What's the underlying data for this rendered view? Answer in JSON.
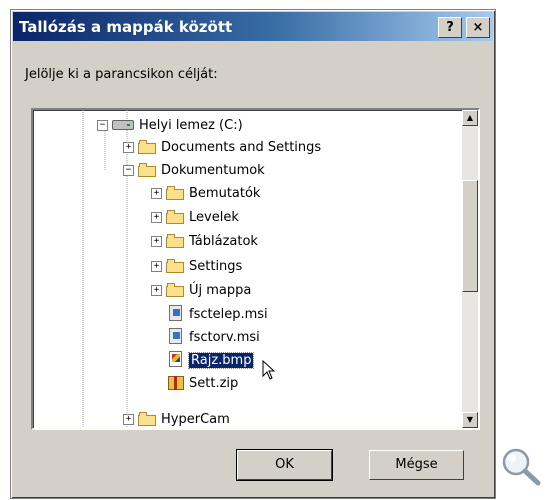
{
  "dialog": {
    "title": "Tallózás a mappák között",
    "help_label": "?",
    "close_label": "×",
    "instruction": "Jelölje ki a parancsikon célját:"
  },
  "tree": {
    "items": [
      {
        "label": "Helyi lemez (C:)",
        "type": "drive",
        "expander": "−"
      },
      {
        "label": "Documents and Settings",
        "type": "folder",
        "expander": "+"
      },
      {
        "label": "Dokumentumok",
        "type": "folder",
        "expander": "−"
      },
      {
        "label": "Bemutatók",
        "type": "folder",
        "expander": "+"
      },
      {
        "label": "Levelek",
        "type": "folder",
        "expander": "+"
      },
      {
        "label": "Táblázatok",
        "type": "folder",
        "expander": "+"
      },
      {
        "label": "Settings",
        "type": "folder",
        "expander": "+"
      },
      {
        "label": "Új mappa",
        "type": "folder",
        "expander": "+"
      },
      {
        "label": "fsctelep.msi",
        "type": "msi-file"
      },
      {
        "label": "fsctorv.msi",
        "type": "msi-file"
      },
      {
        "label": "Rajz.bmp",
        "type": "bmp-file",
        "selected": true
      },
      {
        "label": "Sett.zip",
        "type": "zip-file"
      },
      {
        "label": "HyperCam",
        "type": "folder",
        "expander": "+"
      }
    ]
  },
  "scrollbar": {
    "up_arrow": "▲",
    "down_arrow": "▼"
  },
  "buttons": {
    "ok": "OK",
    "cancel": "Mégse"
  },
  "colors": {
    "title_start": "#0a246a",
    "title_end": "#a6caf0",
    "selection": "#0a246a",
    "face": "#d4d0c8"
  }
}
